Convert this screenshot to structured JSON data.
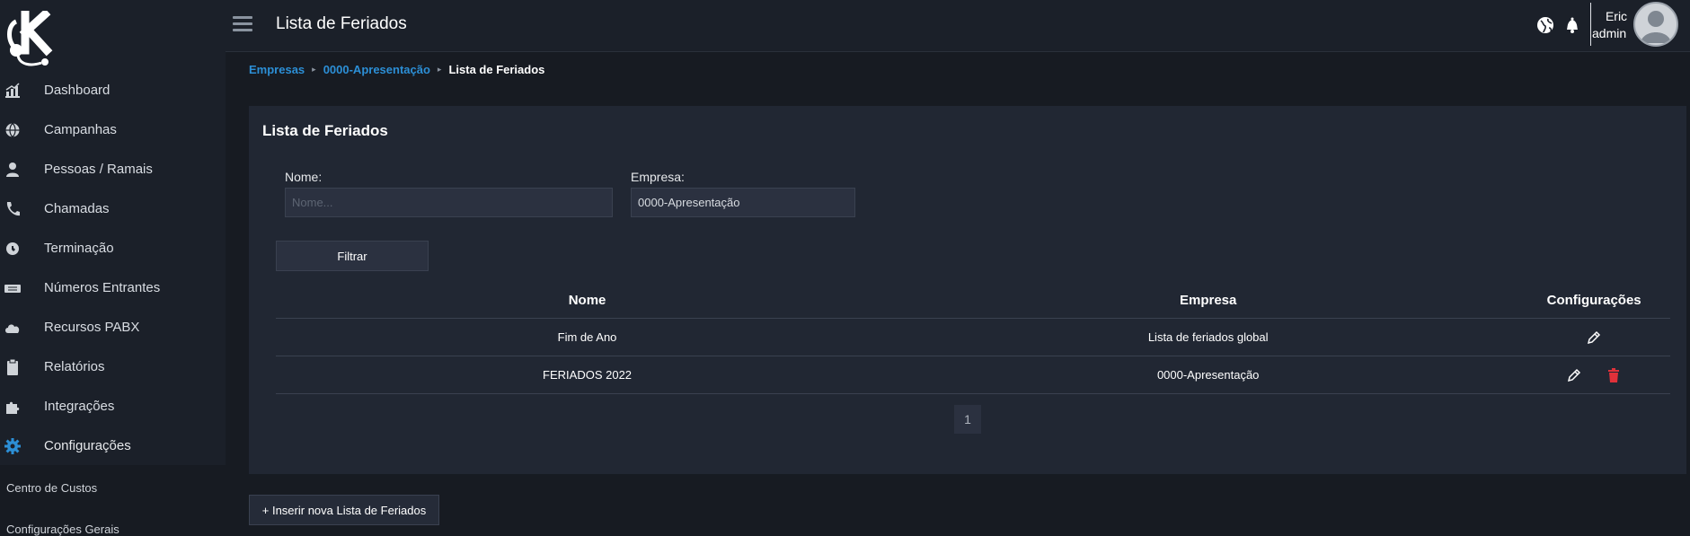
{
  "header": {
    "title": "Lista de Feriados",
    "user_name": "Eric",
    "user_role": "admin"
  },
  "sidebar": {
    "items": [
      {
        "label": "Dashboard",
        "icon": "chart-icon"
      },
      {
        "label": "Campanhas",
        "icon": "globe-icon"
      },
      {
        "label": "Pessoas / Ramais",
        "icon": "person-icon"
      },
      {
        "label": "Chamadas",
        "icon": "phone-icon"
      },
      {
        "label": "Terminação",
        "icon": "globe-phone-icon"
      },
      {
        "label": "Números Entrantes",
        "icon": "number-icon"
      },
      {
        "label": "Recursos PABX",
        "icon": "cloud-icon"
      },
      {
        "label": "Relatórios",
        "icon": "clipboard-icon"
      },
      {
        "label": "Integrações",
        "icon": "puzzle-icon"
      },
      {
        "label": "Configurações",
        "icon": "gear-icon"
      }
    ],
    "submenu": [
      {
        "label": "Centro de Custos"
      },
      {
        "label": "Configurações Gerais"
      }
    ],
    "active_color": "#2c8fd6"
  },
  "breadcrumb": {
    "items": [
      "Empresas",
      "0000-Apresentação",
      "Lista de Feriados"
    ]
  },
  "card": {
    "title": "Lista de Feriados",
    "filters": {
      "nome_label": "Nome:",
      "nome_placeholder": "Nome...",
      "nome_value": "",
      "empresa_label": "Empresa:",
      "empresa_value": "0000-Apresentação"
    },
    "filter_button": "Filtrar",
    "table": {
      "columns": [
        "Nome",
        "Empresa",
        "Configurações"
      ],
      "rows": [
        {
          "nome": "Fim de Ano",
          "empresa": "Lista de feriados global",
          "actions": [
            "edit-icon"
          ]
        },
        {
          "nome": "FERIADOS 2022",
          "empresa": "0000-Apresentação",
          "actions": [
            "edit-icon",
            "trash-icon"
          ]
        }
      ]
    },
    "pagination": {
      "current_page": "1"
    }
  },
  "insert_button": "+ Inserir nova Lista de Feriados",
  "colors": {
    "background": "#171b22",
    "card": "#212733",
    "link": "#2c8fd6",
    "delete": "#e0313a"
  }
}
